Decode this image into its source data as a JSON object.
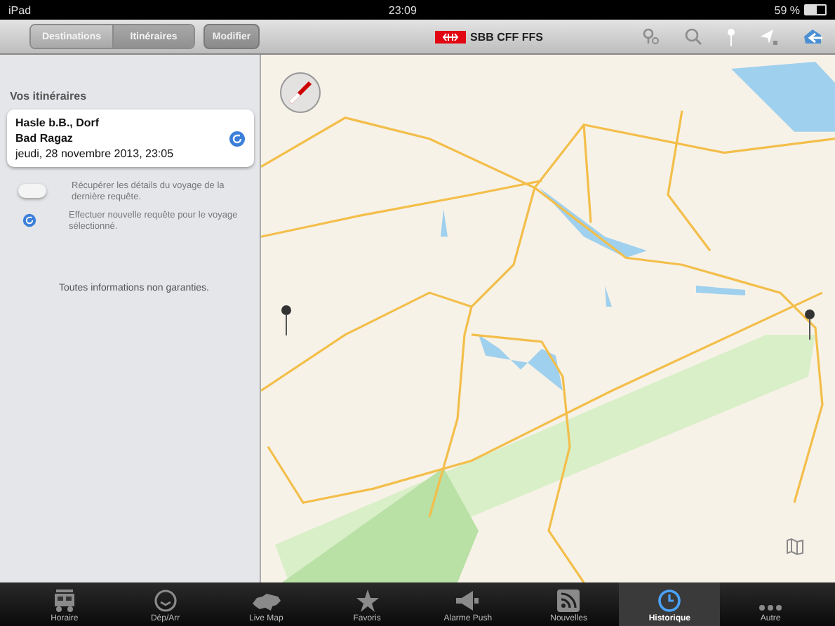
{
  "status_bar": {
    "device": "iPad",
    "time": "23:09",
    "battery": "59 %"
  },
  "toolbar": {
    "segments": [
      {
        "label": "Destinations",
        "selected": false
      },
      {
        "label": "Itinéraires",
        "selected": true
      }
    ],
    "button": "Modifier",
    "logo": "SBB CFF FFS"
  },
  "sidebar": {
    "title": "Vos itinéraires",
    "trip": {
      "from": "Hasle b.B., Dorf",
      "to": "Bad Ragaz",
      "datetime": "jeudi, 28 novembre 2013, 23:05"
    },
    "options": [
      {
        "kind": "toggle",
        "on": false,
        "text": "Récupérer les détails du voyage de la dernière requête."
      },
      {
        "kind": "refresh",
        "text": "Effectuer nouvelle requête pour le voyage sélectionné."
      }
    ],
    "disclaimer": "Toutes informations non garanties."
  },
  "tab_bar": [
    {
      "label": "Horaire",
      "selected": false
    },
    {
      "label": "Dép/Arr",
      "selected": false
    },
    {
      "label": "Live Map",
      "selected": false
    },
    {
      "label": "Favoris",
      "selected": false
    },
    {
      "label": "Alarme Push",
      "selected": false
    },
    {
      "label": "Nouvelles",
      "selected": false
    },
    {
      "label": "Historique",
      "selected": true
    },
    {
      "label": "Autre",
      "selected": false
    }
  ]
}
